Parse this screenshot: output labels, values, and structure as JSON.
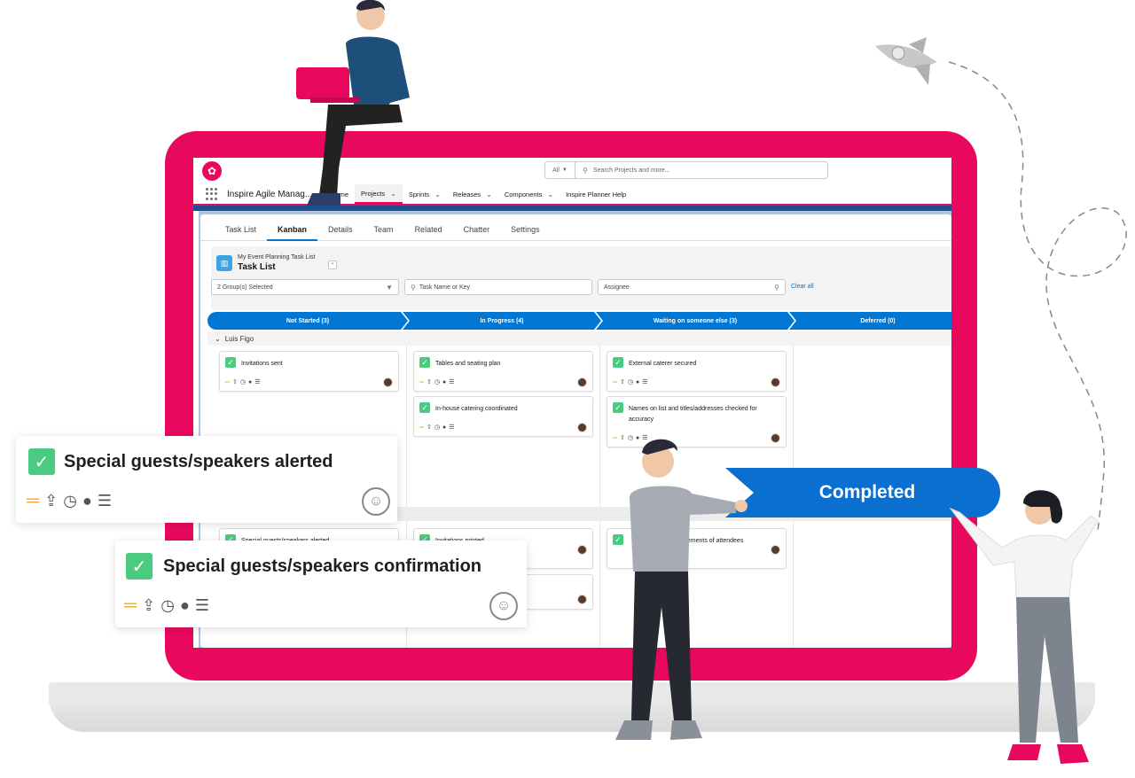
{
  "colors": {
    "brand_pink": "#e8095f",
    "sf_blue": "#0176d3",
    "check_green": "#4bca81",
    "priority_orange": "#f5a623",
    "completed_blue": "#0b6fd0"
  },
  "search": {
    "scope": "All",
    "placeholder": "Search Projects and more..."
  },
  "nav": {
    "app_name": "Inspire Agile Manag...",
    "items": [
      {
        "label": "Home",
        "has_menu": false,
        "active": false
      },
      {
        "label": "Projects",
        "has_menu": true,
        "active": true
      },
      {
        "label": "Sprints",
        "has_menu": true,
        "active": false
      },
      {
        "label": "Releases",
        "has_menu": true,
        "active": false
      },
      {
        "label": "Components",
        "has_menu": true,
        "active": false
      },
      {
        "label": "Inspire Planner Help",
        "has_menu": false,
        "active": false
      }
    ]
  },
  "tabs": [
    {
      "label": "Task List",
      "active": false
    },
    {
      "label": "Kanban",
      "active": true
    },
    {
      "label": "Details",
      "active": false
    },
    {
      "label": "Team",
      "active": false
    },
    {
      "label": "Related",
      "active": false
    },
    {
      "label": "Chatter",
      "active": false
    },
    {
      "label": "Settings",
      "active": false
    }
  ],
  "list_header": {
    "subtitle": "My Event Planning Task List",
    "title": "Task List",
    "group_filter": "2 Group(s) Selected",
    "task_filter_placeholder": "Task Name or Key",
    "assignee_placeholder": "Assignee",
    "clear_all": "Clear all"
  },
  "stages": [
    {
      "label": "Not Started  (3)"
    },
    {
      "label": "In Progress  (4)"
    },
    {
      "label": "Waiting on someone else  (3)"
    },
    {
      "label": "Deferred  (0)"
    }
  ],
  "group": {
    "name": "Luis Figo"
  },
  "cards": {
    "c1": "Invitations sent",
    "c2": "Tables and seating plan",
    "c3": "In-house catering coordinated",
    "c4": "External caterer secured",
    "c5": "Names on list and titles/addresses checked for accuracy",
    "c6": "Special guests/speakers alerted",
    "c7": "Invitations printed",
    "c8": "irements of attendees"
  },
  "floating": {
    "card1_title": "Special guests/speakers alerted",
    "card2_title": "Special guests/speakers confirmation",
    "completed_label": "Completed"
  }
}
